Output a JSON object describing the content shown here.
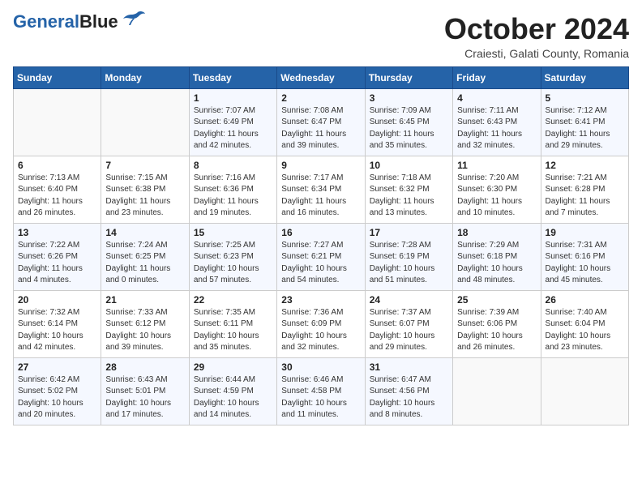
{
  "header": {
    "logo_line1": "General",
    "logo_line2": "Blue",
    "month": "October 2024",
    "location": "Craiesti, Galati County, Romania"
  },
  "weekdays": [
    "Sunday",
    "Monday",
    "Tuesday",
    "Wednesday",
    "Thursday",
    "Friday",
    "Saturday"
  ],
  "weeks": [
    [
      {
        "day": "",
        "info": ""
      },
      {
        "day": "",
        "info": ""
      },
      {
        "day": "1",
        "info": "Sunrise: 7:07 AM\nSunset: 6:49 PM\nDaylight: 11 hours and 42 minutes."
      },
      {
        "day": "2",
        "info": "Sunrise: 7:08 AM\nSunset: 6:47 PM\nDaylight: 11 hours and 39 minutes."
      },
      {
        "day": "3",
        "info": "Sunrise: 7:09 AM\nSunset: 6:45 PM\nDaylight: 11 hours and 35 minutes."
      },
      {
        "day": "4",
        "info": "Sunrise: 7:11 AM\nSunset: 6:43 PM\nDaylight: 11 hours and 32 minutes."
      },
      {
        "day": "5",
        "info": "Sunrise: 7:12 AM\nSunset: 6:41 PM\nDaylight: 11 hours and 29 minutes."
      }
    ],
    [
      {
        "day": "6",
        "info": "Sunrise: 7:13 AM\nSunset: 6:40 PM\nDaylight: 11 hours and 26 minutes."
      },
      {
        "day": "7",
        "info": "Sunrise: 7:15 AM\nSunset: 6:38 PM\nDaylight: 11 hours and 23 minutes."
      },
      {
        "day": "8",
        "info": "Sunrise: 7:16 AM\nSunset: 6:36 PM\nDaylight: 11 hours and 19 minutes."
      },
      {
        "day": "9",
        "info": "Sunrise: 7:17 AM\nSunset: 6:34 PM\nDaylight: 11 hours and 16 minutes."
      },
      {
        "day": "10",
        "info": "Sunrise: 7:18 AM\nSunset: 6:32 PM\nDaylight: 11 hours and 13 minutes."
      },
      {
        "day": "11",
        "info": "Sunrise: 7:20 AM\nSunset: 6:30 PM\nDaylight: 11 hours and 10 minutes."
      },
      {
        "day": "12",
        "info": "Sunrise: 7:21 AM\nSunset: 6:28 PM\nDaylight: 11 hours and 7 minutes."
      }
    ],
    [
      {
        "day": "13",
        "info": "Sunrise: 7:22 AM\nSunset: 6:26 PM\nDaylight: 11 hours and 4 minutes."
      },
      {
        "day": "14",
        "info": "Sunrise: 7:24 AM\nSunset: 6:25 PM\nDaylight: 11 hours and 0 minutes."
      },
      {
        "day": "15",
        "info": "Sunrise: 7:25 AM\nSunset: 6:23 PM\nDaylight: 10 hours and 57 minutes."
      },
      {
        "day": "16",
        "info": "Sunrise: 7:27 AM\nSunset: 6:21 PM\nDaylight: 10 hours and 54 minutes."
      },
      {
        "day": "17",
        "info": "Sunrise: 7:28 AM\nSunset: 6:19 PM\nDaylight: 10 hours and 51 minutes."
      },
      {
        "day": "18",
        "info": "Sunrise: 7:29 AM\nSunset: 6:18 PM\nDaylight: 10 hours and 48 minutes."
      },
      {
        "day": "19",
        "info": "Sunrise: 7:31 AM\nSunset: 6:16 PM\nDaylight: 10 hours and 45 minutes."
      }
    ],
    [
      {
        "day": "20",
        "info": "Sunrise: 7:32 AM\nSunset: 6:14 PM\nDaylight: 10 hours and 42 minutes."
      },
      {
        "day": "21",
        "info": "Sunrise: 7:33 AM\nSunset: 6:12 PM\nDaylight: 10 hours and 39 minutes."
      },
      {
        "day": "22",
        "info": "Sunrise: 7:35 AM\nSunset: 6:11 PM\nDaylight: 10 hours and 35 minutes."
      },
      {
        "day": "23",
        "info": "Sunrise: 7:36 AM\nSunset: 6:09 PM\nDaylight: 10 hours and 32 minutes."
      },
      {
        "day": "24",
        "info": "Sunrise: 7:37 AM\nSunset: 6:07 PM\nDaylight: 10 hours and 29 minutes."
      },
      {
        "day": "25",
        "info": "Sunrise: 7:39 AM\nSunset: 6:06 PM\nDaylight: 10 hours and 26 minutes."
      },
      {
        "day": "26",
        "info": "Sunrise: 7:40 AM\nSunset: 6:04 PM\nDaylight: 10 hours and 23 minutes."
      }
    ],
    [
      {
        "day": "27",
        "info": "Sunrise: 6:42 AM\nSunset: 5:02 PM\nDaylight: 10 hours and 20 minutes."
      },
      {
        "day": "28",
        "info": "Sunrise: 6:43 AM\nSunset: 5:01 PM\nDaylight: 10 hours and 17 minutes."
      },
      {
        "day": "29",
        "info": "Sunrise: 6:44 AM\nSunset: 4:59 PM\nDaylight: 10 hours and 14 minutes."
      },
      {
        "day": "30",
        "info": "Sunrise: 6:46 AM\nSunset: 4:58 PM\nDaylight: 10 hours and 11 minutes."
      },
      {
        "day": "31",
        "info": "Sunrise: 6:47 AM\nSunset: 4:56 PM\nDaylight: 10 hours and 8 minutes."
      },
      {
        "day": "",
        "info": ""
      },
      {
        "day": "",
        "info": ""
      }
    ]
  ]
}
